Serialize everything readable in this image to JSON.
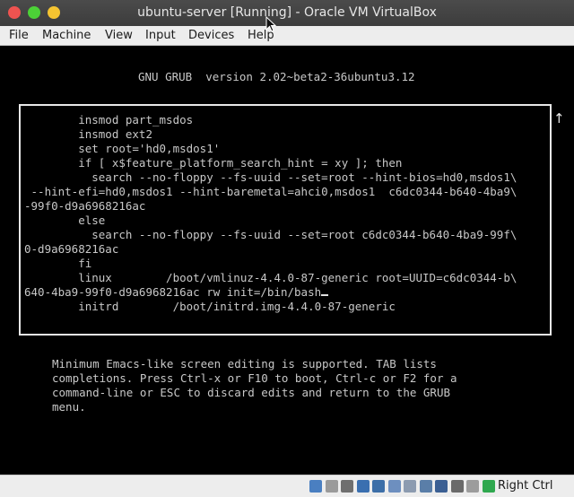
{
  "window": {
    "title": "ubuntu-server [Running] - Oracle VM VirtualBox"
  },
  "menubar": {
    "items": [
      "File",
      "Machine",
      "View",
      "Input",
      "Devices",
      "Help"
    ]
  },
  "grub": {
    "header": "GNU GRUB  version 2.02~beta2-36ubuntu3.12",
    "lines": [
      "        insmod part_msdos",
      "        insmod ext2",
      "        set root='hd0,msdos1'",
      "        if [ x$feature_platform_search_hint = xy ]; then",
      "          search --no-floppy --fs-uuid --set=root --hint-bios=hd0,msdos1\\",
      " --hint-efi=hd0,msdos1 --hint-baremetal=ahci0,msdos1  c6dc0344-b640-4ba9\\",
      "-99f0-d9a6968216ac",
      "        else",
      "          search --no-floppy --fs-uuid --set=root c6dc0344-b640-4ba9-99f\\",
      "0-d9a6968216ac",
      "        fi",
      "        linux        /boot/vmlinuz-4.4.0-87-generic root=UUID=c6dc0344-b\\",
      "640-4ba9-99f0-d9a6968216ac rw init=/bin/bash",
      "        initrd        /boot/initrd.img-4.4.0-87-generic"
    ],
    "scroll_indicator": "↑",
    "help": [
      "Minimum Emacs-like screen editing is supported. TAB lists",
      "completions. Press Ctrl-x or F10 to boot, Ctrl-c or F2 for a",
      "command-line or ESC to discard edits and return to the GRUB",
      "menu."
    ]
  },
  "statusbar": {
    "host_key": "Right Ctrl",
    "icons": [
      {
        "name": "hard-disk-icon",
        "color": "#4a7fc1"
      },
      {
        "name": "optical-disk-icon",
        "color": "#9a9a9a"
      },
      {
        "name": "audio-icon",
        "color": "#6f6f6f"
      },
      {
        "name": "network-icon",
        "color": "#3a6fb0"
      },
      {
        "name": "usb-icon",
        "color": "#3d6fa8"
      },
      {
        "name": "shared-folders-icon",
        "color": "#6d8fbf"
      },
      {
        "name": "display-icon",
        "color": "#8c9bb0"
      },
      {
        "name": "video-capture-icon",
        "color": "#5a7ea8"
      },
      {
        "name": "cpu-icon",
        "color": "#3b5f93"
      },
      {
        "name": "virtualization-icon",
        "color": "#6a6a6a"
      },
      {
        "name": "mouse-integration-icon",
        "color": "#9c9c9c"
      },
      {
        "name": "keyboard-capture-icon",
        "color": "#2fa84f"
      }
    ]
  }
}
